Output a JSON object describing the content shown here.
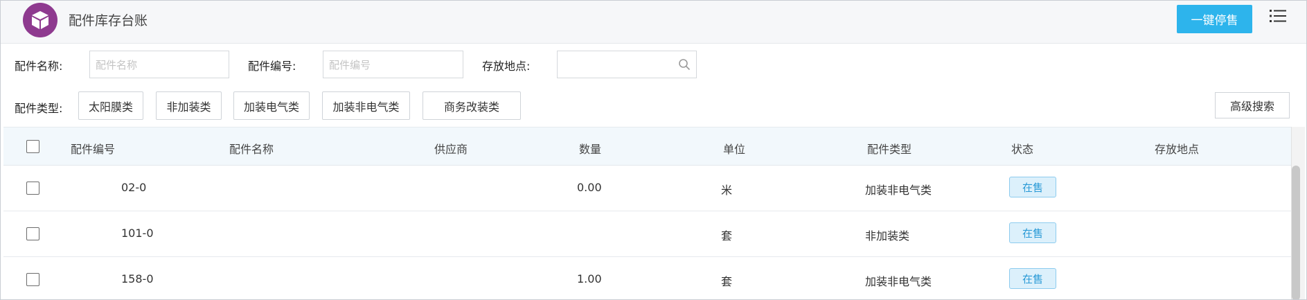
{
  "header": {
    "title": "配件库存台账",
    "stop_sale_button": "一键停售",
    "logo_icon": "cube-icon",
    "menu_icon": "list-menu-icon",
    "logo_color": "#8e3a8f",
    "accent_color": "#2db4ec"
  },
  "filters": {
    "part_name_label": "配件名称:",
    "part_name_placeholder": "配件名称",
    "part_number_label": "配件编号:",
    "part_number_placeholder": "配件编号",
    "location_label": "存放地点:",
    "location_value": "",
    "type_label": "配件类型:",
    "types": [
      "太阳膜类",
      "非加装类",
      "加装电气类",
      "加装非电气类",
      "商务改装类"
    ],
    "advanced_search": "高级搜索"
  },
  "table": {
    "columns": [
      "配件编号",
      "配件名称",
      "供应商",
      "数量",
      "单位",
      "配件类型",
      "状态",
      "存放地点"
    ],
    "rows": [
      {
        "number": "02-0",
        "name": "",
        "supplier": "",
        "quantity": "0.00",
        "unit": "米",
        "type": "加装非电气类",
        "status": "在售",
        "location": ""
      },
      {
        "number": "101-0",
        "name": "",
        "supplier": "",
        "quantity": "",
        "unit": "套",
        "type": "非加装类",
        "status": "在售",
        "location": ""
      },
      {
        "number": "158-0",
        "name": "",
        "supplier": "",
        "quantity": "1.00",
        "unit": "套",
        "type": "加装非电气类",
        "status": "在售",
        "location": ""
      }
    ],
    "status_color": "#2a9ad6"
  }
}
